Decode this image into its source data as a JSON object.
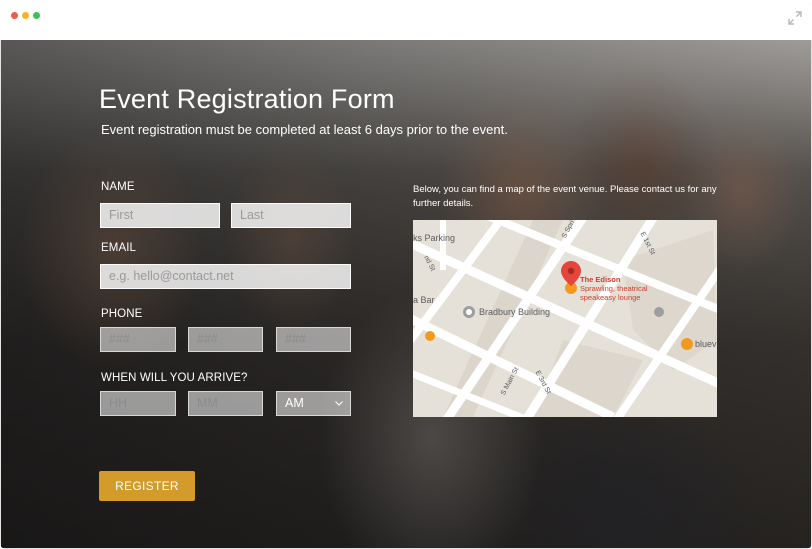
{
  "window": {
    "controls": [
      "close",
      "minimize",
      "maximize"
    ],
    "expand_icon": "expand-arrows-icon"
  },
  "form": {
    "title": "Event Registration Form",
    "subtitle": "Event registration must be completed at least 6 days prior to the event.",
    "name": {
      "label": "NAME",
      "first_placeholder": "First",
      "last_placeholder": "Last"
    },
    "email": {
      "label": "EMAIL",
      "placeholder": "e.g. hello@contact.net"
    },
    "phone": {
      "label": "PHONE",
      "part1_placeholder": "###",
      "part2_placeholder": "###",
      "part3_placeholder": "###"
    },
    "arrival": {
      "label": "WHEN WILL YOU ARRIVE?",
      "hour_placeholder": "HH",
      "minute_placeholder": "MM",
      "ampm_selected": "AM"
    },
    "submit_label": "REGISTER"
  },
  "map": {
    "note": "Below, you can find a map of the event venue. Please contact us for any further details.",
    "labels": {
      "parking": "ks Parking",
      "bar": "a Bar",
      "bradbury": "Bradbury Building",
      "bluev": "bluev",
      "s_spring": "S Spri",
      "e_1st": "E 1st St",
      "e_2nd": "E 2nd St",
      "e_3rd": "E 3rd St",
      "s_main": "S Main St",
      "nd_st": "nd St"
    },
    "venue": {
      "name": "The Edison",
      "description": "Sprawling, theatrical speakeasy lounge"
    },
    "colors": {
      "land": "#e6e1d8",
      "road": "#ffffff",
      "block": "#dbd5cc",
      "pin": "#e5453a",
      "poi": "#f29a1f"
    }
  },
  "colors": {
    "accent": "#d29b2a",
    "text_on_dark": "#ffffff"
  }
}
